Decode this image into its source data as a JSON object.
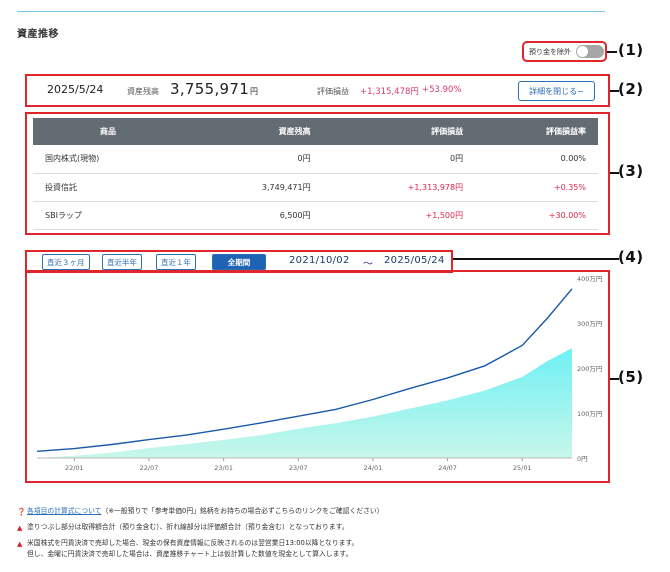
{
  "page": {
    "title": "資産推移"
  },
  "toggle": {
    "label": "預り金を除外",
    "on": false
  },
  "callouts": [
    "(1)",
    "(2)",
    "(3)",
    "(4)",
    "(5)"
  ],
  "summary": {
    "date": "2025/5/24",
    "balance_label": "資産残高",
    "balance": "3,755,971",
    "balance_unit": "円",
    "pl_label": "評価損益",
    "pl": "+1,315,478円",
    "pl_pct": "+53.90%",
    "detail_button": "詳細を閉じる−"
  },
  "table": {
    "headers": [
      "商品",
      "資産残高",
      "評価損益",
      "評価損益率"
    ],
    "rows": [
      [
        "国内株式(現物)",
        "0円",
        "0円",
        "0.00%"
      ],
      [
        "投資信託",
        "3,749,471円",
        "+1,313,978円",
        "+0.35%"
      ],
      [
        "SBIラップ",
        "6,500円",
        "+1,500円",
        "+30.00%"
      ]
    ]
  },
  "range": {
    "buttons": [
      "直近３ヶ月",
      "直近半年",
      "直近１年",
      "全期間"
    ],
    "active_index": 3,
    "from": "2021/10/02",
    "separator": "〜",
    "to": "2025/05/24"
  },
  "chart_data": {
    "type": "area",
    "x_ticks": [
      "22/01",
      "22/07",
      "23/01",
      "23/07",
      "24/01",
      "24/07",
      "25/01"
    ],
    "y_ticks": [
      "0円",
      "100万円",
      "200万円",
      "300万円",
      "400万円"
    ],
    "ylim": [
      0,
      4000000
    ],
    "series": [
      {
        "kind": "area",
        "color": "#7ff0f0",
        "points": [
          [
            "2021-10",
            0
          ],
          [
            "2022-01",
            50000
          ],
          [
            "2022-04",
            120000
          ],
          [
            "2022-07",
            220000
          ],
          [
            "2022-10",
            310000
          ],
          [
            "2023-01",
            400000
          ],
          [
            "2023-04",
            510000
          ],
          [
            "2023-07",
            650000
          ],
          [
            "2023-10",
            770000
          ],
          [
            "2024-01",
            920000
          ],
          [
            "2024-04",
            1100000
          ],
          [
            "2024-07",
            1280000
          ],
          [
            "2024-10",
            1500000
          ],
          [
            "2025-01",
            1800000
          ],
          [
            "2025-03",
            2150000
          ],
          [
            "2025-05",
            2440000
          ]
        ]
      },
      {
        "kind": "line",
        "color": "#1a5aaa",
        "points": [
          [
            "2021-10",
            150000
          ],
          [
            "2022-01",
            210000
          ],
          [
            "2022-04",
            300000
          ],
          [
            "2022-07",
            410000
          ],
          [
            "2022-10",
            510000
          ],
          [
            "2023-01",
            640000
          ],
          [
            "2023-04",
            780000
          ],
          [
            "2023-07",
            930000
          ],
          [
            "2023-10",
            1080000
          ],
          [
            "2024-01",
            1300000
          ],
          [
            "2024-04",
            1550000
          ],
          [
            "2024-07",
            1780000
          ],
          [
            "2024-10",
            2050000
          ],
          [
            "2025-01",
            2500000
          ],
          [
            "2025-03",
            3100000
          ],
          [
            "2025-05",
            3760000
          ]
        ]
      }
    ],
    "grid": false
  },
  "notes": [
    {
      "icon": "info-icon",
      "link": "各項目の計算式について",
      "text": "（※一般預りで「参考単価0円」銘柄をお持ちの場合必ずこちらのリンクをご確認ください）"
    },
    {
      "icon": "warning-icon",
      "text": "塗りつぶし部分は取得額合計（預り金含む）、折れ線部分は評価額合計（預り金含む）となっております。"
    },
    {
      "icon": "warning-icon",
      "text": "米国株式を円貨決済で売却した場合、現金の保有資産情報に反映されるのは翌営業日13:00以降となります。",
      "text2": "但し、金曜に円貨決済で売却した場合は、資産推移チャート上は仮計算した数値を現金として算入します。"
    }
  ]
}
